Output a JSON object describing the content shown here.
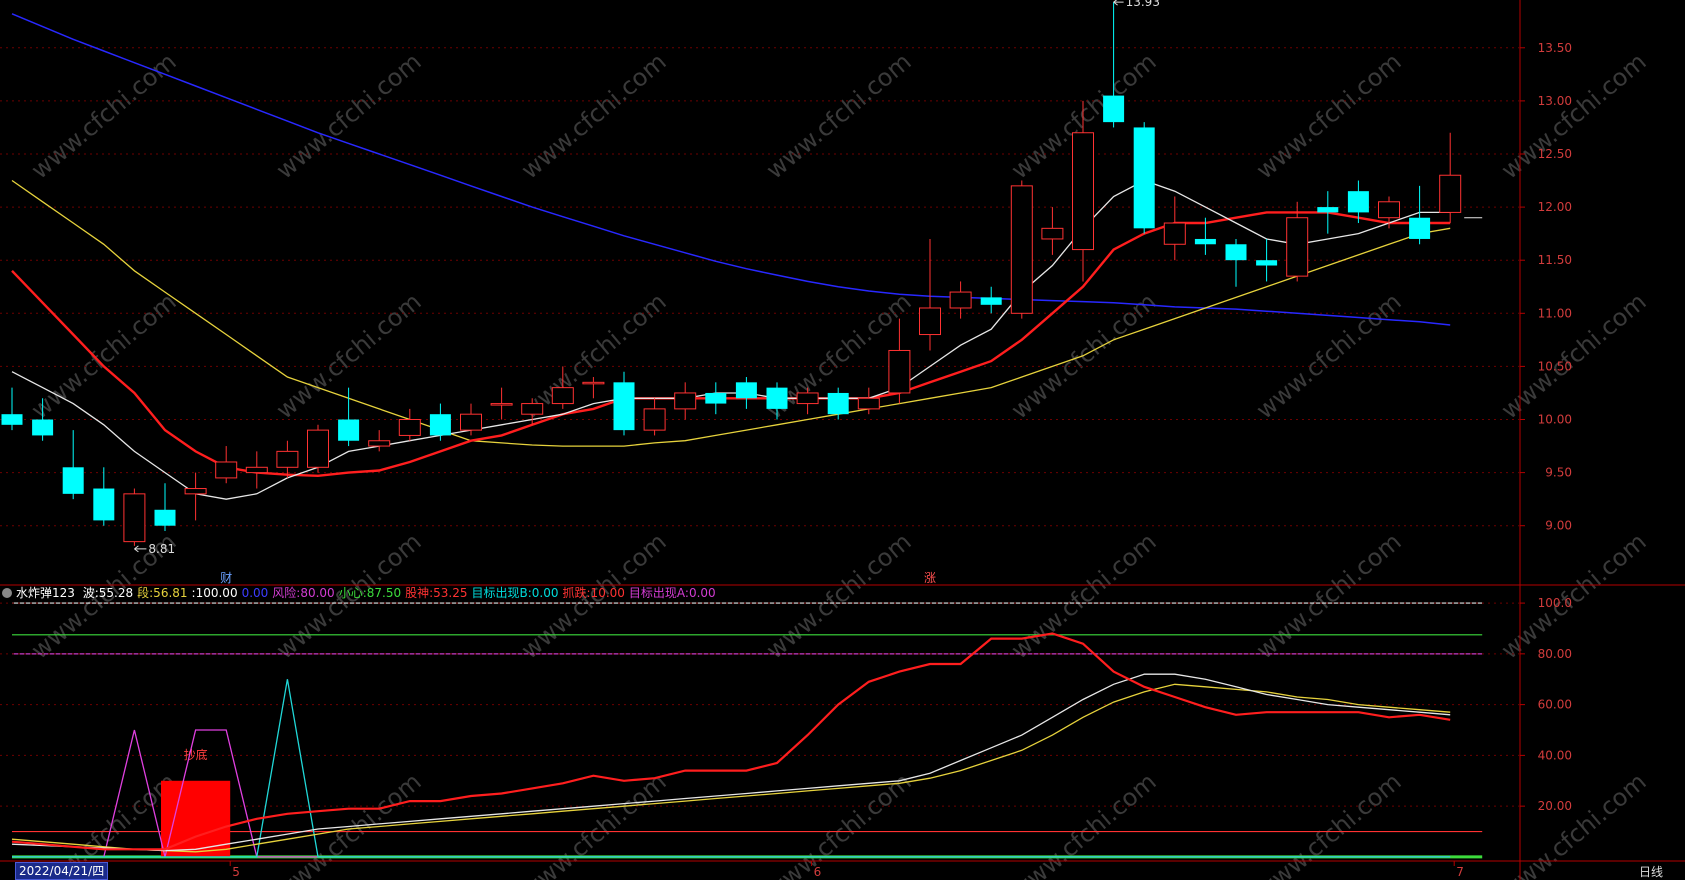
{
  "colors": {
    "background": "#000000",
    "up": "#ff3232",
    "down": "#00ffff",
    "ma_white": "#e6e6e6",
    "ma_red": "#ff1e1e",
    "ma_yellow": "#e6d23c",
    "ma_blue": "#2828ff",
    "axis_red": "#b40000",
    "grid": "#6e0000",
    "price_label": "#d23c3c"
  },
  "price_axis": {
    "ticks": [
      "13.50",
      "13.00",
      "12.50",
      "12.00",
      "11.50",
      "11.00",
      "10.50",
      "10.00",
      "9.50",
      "9.00"
    ],
    "ylim": [
      8.63,
      13.95
    ]
  },
  "indicator_axis": {
    "ticks": [
      "100.0",
      "80.00",
      "60.00",
      "40.00",
      "20.00"
    ],
    "ylim": [
      -2,
      102
    ]
  },
  "chart_data": {
    "type": "candlestick",
    "x_count": 48,
    "candles": [
      [
        10.05,
        9.95,
        10.3,
        9.9
      ],
      [
        10.0,
        9.85,
        10.2,
        9.8
      ],
      [
        9.55,
        9.3,
        9.9,
        9.25
      ],
      [
        9.35,
        9.05,
        9.55,
        9.0
      ],
      [
        8.85,
        9.3,
        9.35,
        8.81
      ],
      [
        9.15,
        9.0,
        9.4,
        8.95
      ],
      [
        9.3,
        9.35,
        9.5,
        9.05
      ],
      [
        9.45,
        9.6,
        9.75,
        9.4
      ],
      [
        9.5,
        9.55,
        9.7,
        9.35
      ],
      [
        9.55,
        9.7,
        9.8,
        9.45
      ],
      [
        9.55,
        9.9,
        9.95,
        9.5
      ],
      [
        10.0,
        9.8,
        10.3,
        9.75
      ],
      [
        9.75,
        9.8,
        9.9,
        9.7
      ],
      [
        9.85,
        10.0,
        10.1,
        9.8
      ],
      [
        10.05,
        9.85,
        10.15,
        9.8
      ],
      [
        9.9,
        10.05,
        10.15,
        9.85
      ],
      [
        10.15,
        10.15,
        10.3,
        10.0
      ],
      [
        10.05,
        10.15,
        10.2,
        9.95
      ],
      [
        10.15,
        10.3,
        10.5,
        10.1
      ],
      [
        10.35,
        10.35,
        10.4,
        10.2
      ],
      [
        10.35,
        9.9,
        10.45,
        9.85
      ],
      [
        9.9,
        10.1,
        10.2,
        9.85
      ],
      [
        10.1,
        10.25,
        10.35,
        10.0
      ],
      [
        10.25,
        10.15,
        10.35,
        10.05
      ],
      [
        10.35,
        10.2,
        10.4,
        10.1
      ],
      [
        10.3,
        10.1,
        10.35,
        10.0
      ],
      [
        10.15,
        10.25,
        10.3,
        10.05
      ],
      [
        10.25,
        10.05,
        10.3,
        10.0
      ],
      [
        10.1,
        10.2,
        10.3,
        10.05
      ],
      [
        10.25,
        10.65,
        10.95,
        10.15
      ],
      [
        10.8,
        11.05,
        11.7,
        10.65
      ],
      [
        11.05,
        11.2,
        11.3,
        10.95
      ],
      [
        11.15,
        11.08,
        11.25,
        11.0
      ],
      [
        11.0,
        12.2,
        12.25,
        10.95
      ],
      [
        11.7,
        11.8,
        12.0,
        11.55
      ],
      [
        11.6,
        12.7,
        13.0,
        11.3
      ],
      [
        13.05,
        12.8,
        13.93,
        12.75
      ],
      [
        12.75,
        11.8,
        12.8,
        11.75
      ],
      [
        11.65,
        11.85,
        12.1,
        11.5
      ],
      [
        11.7,
        11.65,
        11.9,
        11.55
      ],
      [
        11.65,
        11.5,
        11.7,
        11.25
      ],
      [
        11.5,
        11.45,
        11.7,
        11.3
      ],
      [
        11.35,
        11.9,
        12.05,
        11.3
      ],
      [
        12.0,
        11.95,
        12.15,
        11.75
      ],
      [
        12.15,
        11.95,
        12.25,
        11.85
      ],
      [
        11.9,
        12.05,
        12.1,
        11.8
      ],
      [
        11.9,
        11.7,
        12.2,
        11.65
      ],
      [
        11.95,
        12.3,
        12.7,
        11.85
      ]
    ],
    "last_close_ticks": [
      11.9,
      11.9
    ],
    "ma_white": [
      10.45,
      10.3,
      10.15,
      9.95,
      9.7,
      9.5,
      9.3,
      9.25,
      9.3,
      9.45,
      9.55,
      9.7,
      9.75,
      9.8,
      9.85,
      9.9,
      9.95,
      10.0,
      10.05,
      10.15,
      10.2,
      10.2,
      10.2,
      10.25,
      10.25,
      10.2,
      10.2,
      10.2,
      10.2,
      10.3,
      10.5,
      10.7,
      10.85,
      11.2,
      11.45,
      11.8,
      12.1,
      12.25,
      12.15,
      12.0,
      11.85,
      11.7,
      11.65,
      11.7,
      11.75,
      11.85,
      11.95,
      11.95
    ],
    "ma_red": [
      11.4,
      11.1,
      10.8,
      10.5,
      10.25,
      9.9,
      9.7,
      9.55,
      9.5,
      9.48,
      9.47,
      9.5,
      9.52,
      9.6,
      9.7,
      9.8,
      9.85,
      9.95,
      10.05,
      10.1,
      10.2,
      10.2,
      10.2,
      10.2,
      10.2,
      10.2,
      10.2,
      10.2,
      10.2,
      10.25,
      10.35,
      10.45,
      10.55,
      10.75,
      11.0,
      11.25,
      11.6,
      11.75,
      11.85,
      11.85,
      11.9,
      11.95,
      11.95,
      11.95,
      11.9,
      11.85,
      11.85,
      11.85
    ],
    "ma_yellow": [
      12.25,
      12.05,
      11.85,
      11.65,
      11.4,
      11.2,
      11.0,
      10.8,
      10.6,
      10.4,
      10.3,
      10.2,
      10.1,
      10.0,
      9.9,
      9.8,
      9.78,
      9.76,
      9.75,
      9.75,
      9.75,
      9.78,
      9.8,
      9.85,
      9.9,
      9.95,
      10.0,
      10.05,
      10.1,
      10.15,
      10.2,
      10.25,
      10.3,
      10.4,
      10.5,
      10.6,
      10.75,
      10.85,
      10.95,
      11.05,
      11.15,
      11.25,
      11.35,
      11.45,
      11.55,
      11.65,
      11.75,
      11.8
    ],
    "ma_blue": [
      13.82,
      13.7,
      13.58,
      13.47,
      13.36,
      13.25,
      13.14,
      13.03,
      12.92,
      12.81,
      12.7,
      12.6,
      12.5,
      12.4,
      12.3,
      12.2,
      12.1,
      12.0,
      11.91,
      11.82,
      11.73,
      11.65,
      11.57,
      11.49,
      11.42,
      11.36,
      11.3,
      11.25,
      11.21,
      11.18,
      11.16,
      11.15,
      11.14,
      11.13,
      11.12,
      11.11,
      11.1,
      11.08,
      11.06,
      11.05,
      11.04,
      11.02,
      11.0,
      10.98,
      10.96,
      10.94,
      10.92,
      10.89
    ],
    "annotations": {
      "high_label": "13.93",
      "low_label": "8.81",
      "marker_cai": "财",
      "marker_zhang": "涨"
    },
    "indicator": {
      "name": "水炸弹123",
      "header": [
        {
          "label": "波:",
          "value": "55.28",
          "color": "#ffffff"
        },
        {
          "label": "段:",
          "value": "56.81",
          "color": "#e6d23c"
        },
        {
          "label": ":",
          "value": "100.00",
          "color": "#ffffff"
        },
        {
          "label": "",
          "value": "0.00",
          "color": "#3c3cff"
        },
        {
          "label": "风险:",
          "value": "80.00",
          "color": "#d23cd2"
        },
        {
          "label": "小心:",
          "value": "87.50",
          "color": "#3cdc3c"
        },
        {
          "label": "股神:",
          "value": "53.25",
          "color": "#ff3232"
        },
        {
          "label": "目标出现B:",
          "value": "0.00",
          "color": "#00dcdc"
        },
        {
          "label": "抓跌:",
          "value": "10.00",
          "color": "#ff3232"
        },
        {
          "label": "目标出现A:",
          "value": "0.00",
          "color": "#d23cd2"
        }
      ],
      "hlines": [
        {
          "value": 100,
          "color": "#e6e6e6"
        },
        {
          "value": 87.5,
          "color": "#3cdc3c"
        },
        {
          "value": 80,
          "color": "#c83cc8"
        },
        {
          "value": 10,
          "color": "#ff3232"
        },
        {
          "value": 0,
          "color": "#3cdc3c"
        }
      ],
      "red_line": [
        6,
        5,
        4,
        3,
        3,
        3,
        8,
        12,
        15,
        17,
        18,
        19,
        19,
        22,
        22,
        24,
        25,
        27,
        29,
        32,
        30,
        31,
        34,
        34,
        34,
        37,
        48,
        60,
        69,
        73,
        76,
        76,
        86,
        86,
        88,
        84,
        73,
        67,
        63,
        59,
        56,
        57,
        57,
        57,
        57,
        55,
        56,
        54
      ],
      "white_line": [
        5,
        4.5,
        4,
        3.5,
        3,
        2.5,
        3,
        5,
        7,
        9,
        11,
        12,
        13,
        14,
        15,
        16,
        17,
        18,
        19,
        20,
        21,
        22,
        23,
        24,
        25,
        26,
        27,
        28,
        29,
        30,
        33,
        38,
        43,
        48,
        55,
        62,
        68,
        72,
        72,
        70,
        67,
        64,
        62,
        60,
        59,
        58,
        57,
        56
      ],
      "yellow_line": [
        7,
        6,
        5,
        4,
        3,
        2.5,
        2,
        3,
        5,
        7,
        9,
        11,
        12,
        13,
        14,
        15,
        16,
        17,
        18,
        19,
        20,
        21,
        22,
        23,
        24,
        25,
        26,
        27,
        28,
        29,
        31,
        34,
        38,
        42,
        48,
        55,
        61,
        65,
        68,
        67,
        66,
        65,
        63,
        62,
        60,
        59,
        58,
        57
      ],
      "magenta_spikes": [
        0,
        0,
        0,
        0,
        50,
        0,
        50,
        50,
        0,
        0,
        0,
        0,
        0,
        0,
        0,
        0,
        0,
        0,
        0,
        0,
        0,
        0,
        0,
        0,
        0,
        0,
        0,
        0,
        0,
        0,
        0,
        0,
        0,
        0,
        0,
        0,
        0,
        0,
        0,
        0,
        0,
        0,
        0,
        0,
        0,
        0,
        0,
        0
      ],
      "cyan_spikes": [
        0,
        0,
        0,
        0,
        0,
        0,
        0,
        0,
        0,
        70,
        0,
        0,
        0,
        0,
        0,
        0,
        0,
        0,
        0,
        0,
        0,
        0,
        0,
        0,
        0,
        0,
        0,
        0,
        0,
        0,
        0,
        0,
        0,
        0,
        0,
        0,
        0,
        0,
        0,
        0,
        0,
        0,
        0,
        0,
        0,
        0,
        0,
        0
      ],
      "block": {
        "from_index": 5,
        "to_index": 7,
        "value": 30,
        "label": "抄底"
      }
    },
    "x_labels": [
      {
        "index": 7,
        "text": "5"
      },
      {
        "index": 26,
        "text": "6"
      },
      {
        "index": 47,
        "text": "7"
      }
    ]
  },
  "date_label": "2022/04/21/四",
  "period_label": "日线",
  "watermark": "www.cfchi.com"
}
